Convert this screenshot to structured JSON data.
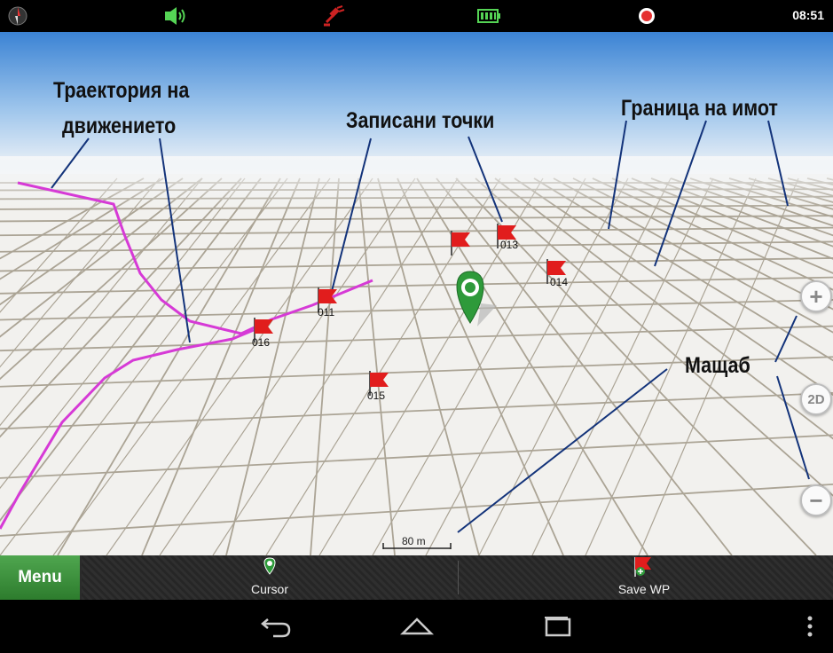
{
  "status_bar": {
    "time": "08:51",
    "icons": [
      "compass-icon",
      "volume-icon",
      "satellite-icon",
      "battery-icon",
      "record-icon"
    ],
    "colors": {
      "volume": "#55d455",
      "satellite": "#cc2222",
      "battery": "#55d455",
      "record": "#e53030"
    }
  },
  "annotations": {
    "trajectory": [
      "Траектория на",
      "движението"
    ],
    "recorded_points": "Записани точки",
    "property_boundary": "Граница на имот",
    "scale": "Мащаб"
  },
  "waypoints": [
    "",
    "013",
    "014",
    "011",
    "016",
    "015"
  ],
  "scale_bar": {
    "label": "80 m"
  },
  "zoom_controls": {
    "mode_label": "2D",
    "zoom_in": "+",
    "zoom_out": "−"
  },
  "toolbar": {
    "menu_label": "Menu",
    "cursor_label": "Cursor",
    "save_wp_label": "Save WP",
    "menu_color": "#3a8f3a"
  },
  "nav_bar": {
    "icons": [
      "back-icon",
      "home-icon",
      "recents-icon",
      "overflow-menu-icon"
    ]
  },
  "map_colors": {
    "sky": "#3b83d4",
    "track": "#d63ad6",
    "pin": "#2e9a3a",
    "flag": "#e11d1d"
  }
}
